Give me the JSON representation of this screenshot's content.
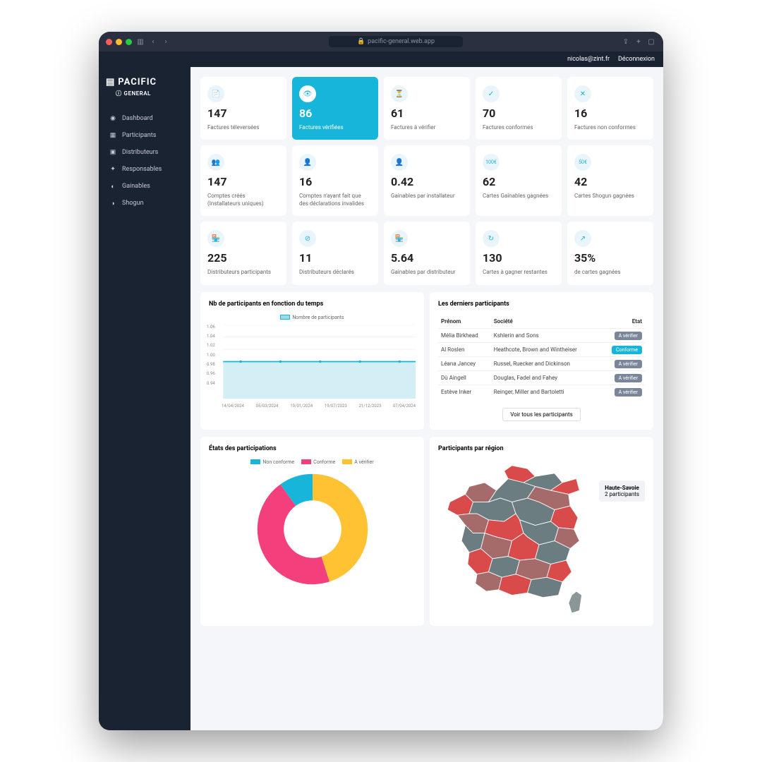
{
  "browser": {
    "url": "pacific-general.web.app"
  },
  "topbar": {
    "email": "nicolas@zint.fr",
    "logout": "Déconnexion"
  },
  "brand": {
    "name": "PACIFIC",
    "sub": "GENERAL"
  },
  "sidebar": {
    "items": [
      {
        "label": "Dashboard"
      },
      {
        "label": "Participants"
      },
      {
        "label": "Distributeurs"
      },
      {
        "label": "Responsables"
      },
      {
        "label": "Gainables"
      },
      {
        "label": "Shogun"
      }
    ]
  },
  "cards": [
    {
      "value": "147",
      "label": "Factures téleversées",
      "icon": "doc-icon"
    },
    {
      "value": "86",
      "label": "Factures vérifiées",
      "icon": "eye-icon",
      "highlight": true
    },
    {
      "value": "61",
      "label": "Factures à vérifier",
      "icon": "hourglass-icon"
    },
    {
      "value": "70",
      "label": "Factures conformes",
      "icon": "check-icon"
    },
    {
      "value": "16",
      "label": "Factures non conformes",
      "icon": "x-icon"
    },
    {
      "value": "147",
      "label": "Comptes créés (Installateurs uniques)",
      "icon": "users-icon"
    },
    {
      "value": "16",
      "label": "Comptes n'ayant fait que des déclarations invalides",
      "icon": "user-icon"
    },
    {
      "value": "0.42",
      "label": "Gainables par installateur",
      "icon": "user-icon"
    },
    {
      "value": "62",
      "label": "Cartes Gainables gagnées",
      "icon": "badge100-icon"
    },
    {
      "value": "42",
      "label": "Cartes Shogun gagnées",
      "icon": "badge50-icon"
    },
    {
      "value": "225",
      "label": "Distributeurs participants",
      "icon": "shop-icon"
    },
    {
      "value": "11",
      "label": "Distributeurs déclarés",
      "icon": "slash-icon"
    },
    {
      "value": "5.64",
      "label": "Gainables par distributeur",
      "icon": "shop-icon"
    },
    {
      "value": "130",
      "label": "Cartes à gagner restantes",
      "icon": "history-icon"
    },
    {
      "value": "35%",
      "label": "de cartes gagnées",
      "icon": "trend-icon"
    }
  ],
  "linechart": {
    "title": "Nb de participants en fonction du temps",
    "legend": "Nombre de participants"
  },
  "recent": {
    "title": "Les derniers participants",
    "cols": {
      "c1": "Prénom",
      "c2": "Société",
      "c3": "Etat"
    },
    "rows": [
      {
        "name": "Mélia Birkhead",
        "company": "Kshlerin and Sons",
        "state": "A vérifier",
        "cls": "b-verif"
      },
      {
        "name": "Al Roslen",
        "company": "Heathcote, Brown and Wintheiser",
        "state": "Conforme",
        "cls": "b-conf"
      },
      {
        "name": "Léana Jancey",
        "company": "Russel, Ruecker and Dickinson",
        "state": "A vérifier",
        "cls": "b-verif"
      },
      {
        "name": "Dù Aingell",
        "company": "Douglas, Fadel and Fahey",
        "state": "A vérifier",
        "cls": "b-verif"
      },
      {
        "name": "Estève Inker",
        "company": "Reinger, Miller and Bartoletti",
        "state": "A vérifier",
        "cls": "b-verif"
      }
    ],
    "viewall": "Voir tous les participants"
  },
  "pie": {
    "title": "États des participations",
    "legend": {
      "a": "Non conforme",
      "b": "Conforme",
      "c": "A vérifier"
    }
  },
  "map": {
    "title": "Participants par région",
    "callout": {
      "region": "Haute-Savoie",
      "count": "2 participants"
    }
  },
  "chart_data": [
    {
      "type": "line",
      "title": "Nb de participants en fonction du temps",
      "series": [
        {
          "name": "Nombre de participants",
          "values": [
            1.0,
            1.0,
            1.0,
            1.0,
            1.0
          ]
        }
      ],
      "x": [
        "14/04/2024",
        "05/03/2024",
        "19/01/2024",
        "19/07/2023",
        "21/12/2023",
        "07/04/2024"
      ],
      "ylim": [
        0.94,
        1.06
      ],
      "yticks": [
        0.94,
        0.96,
        0.98,
        1.0,
        1.02,
        1.04,
        1.06
      ]
    },
    {
      "type": "pie",
      "title": "États des participations",
      "categories": [
        "Non conforme",
        "Conforme",
        "A vérifier"
      ],
      "values": [
        10,
        45,
        45
      ],
      "colors": [
        "#16b5d9",
        "#f43f7d",
        "#ffc233"
      ]
    }
  ]
}
